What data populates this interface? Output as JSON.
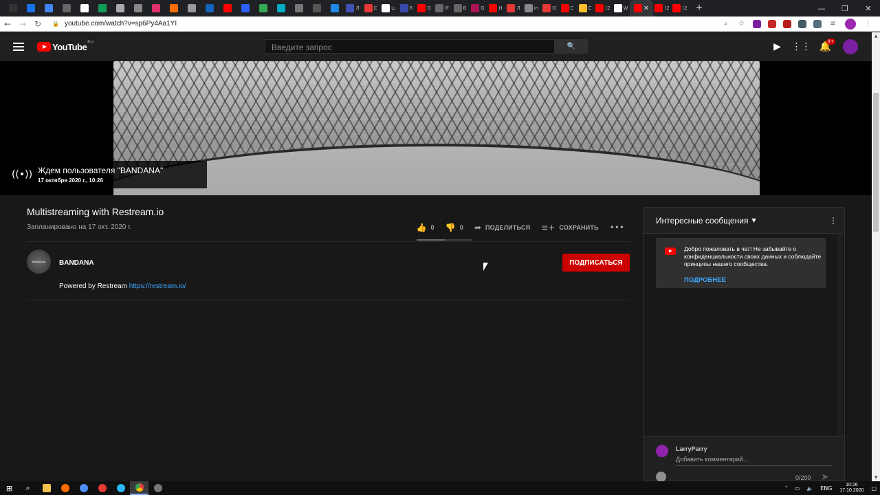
{
  "browser": {
    "tabs": [
      {
        "label": "",
        "color": "#333333"
      },
      {
        "label": "",
        "color": "#1a73e8"
      },
      {
        "label": "",
        "color": "#4285f4"
      },
      {
        "label": "",
        "color": "#666666"
      },
      {
        "label": "",
        "color": "#ffffff"
      },
      {
        "label": "",
        "color": "#0f9d58"
      },
      {
        "label": "",
        "color": "#aaaaaa"
      },
      {
        "label": "",
        "color": "#888888"
      },
      {
        "label": "",
        "color": "#e1306c"
      },
      {
        "label": "",
        "color": "#ff6d00"
      },
      {
        "label": "",
        "color": "#999999"
      },
      {
        "label": "",
        "color": "#1565c0"
      },
      {
        "label": "",
        "color": "#ff0000"
      },
      {
        "label": "",
        "color": "#2962ff"
      },
      {
        "label": "",
        "color": "#34a853"
      },
      {
        "label": "",
        "color": "#00acc1"
      },
      {
        "label": "",
        "color": "#777777"
      },
      {
        "label": "",
        "color": "#555555"
      },
      {
        "label": "",
        "color": "#1e88e5"
      },
      {
        "label": "Л",
        "color": "#3f51b5"
      },
      {
        "label": "С",
        "color": "#e53935"
      },
      {
        "label": "Lı",
        "color": "#ffffff"
      },
      {
        "label": "R",
        "color": "#3949ab"
      },
      {
        "label": "О",
        "color": "#ff0000"
      },
      {
        "label": "IF",
        "color": "#666666"
      },
      {
        "label": "В",
        "color": "#666666"
      },
      {
        "label": "G",
        "color": "#ad1457"
      },
      {
        "label": "Н",
        "color": "#ff0000"
      },
      {
        "label": "Л",
        "color": "#e53935"
      },
      {
        "label": "in",
        "color": "#888888"
      },
      {
        "label": "О",
        "color": "#e53935"
      },
      {
        "label": "С",
        "color": "#ff0000"
      },
      {
        "label": "С",
        "color": "#fbc02d"
      },
      {
        "label": "(2",
        "color": "#ff0000"
      },
      {
        "label": "W",
        "color": "#ffffff"
      },
      {
        "label": "",
        "color": "#ff0000"
      },
      {
        "label": "(2",
        "color": "#ff0000"
      },
      {
        "label": "(2",
        "color": "#ff0000"
      }
    ],
    "new_tab": "+",
    "url": "youtube.com/watch?v=sp6Py4Aa1YI",
    "window_controls": {
      "minimize": "—",
      "restore": "❐",
      "close": "✕"
    }
  },
  "masthead": {
    "logo_text": "YouTube",
    "logo_region": "RU",
    "search_placeholder": "Введите запрос",
    "notification_count": "9+"
  },
  "video": {
    "waiting_title": "Ждем пользователя \"BANDANA\"",
    "waiting_date": "17 октября 2020 г., 10:26"
  },
  "info": {
    "title": "Multistreaming with Restream.io",
    "scheduled": "Запланировано на 17 окт. 2020 г.",
    "likes": "0",
    "dislikes": "0",
    "share_label": "ПОДЕЛИТЬСЯ",
    "save_label": "СОХРАНИТЬ",
    "like_ratio": 0.5
  },
  "owner": {
    "name": "BANDANA",
    "avatar_text": "BANDANA",
    "subscribe_label": "ПОДПИСАТЬСЯ",
    "description_text": "Powered by Restream ",
    "description_link": "https://restream.io/"
  },
  "chat": {
    "header_title": "Интересные сообщения",
    "welcome_text": "Добро пожаловать в чат! Не забывайте о конфиденциальности своих данных и соблюдайте принципы нашего сообщества.",
    "welcome_link": "ПОДРОБНЕЕ",
    "username": "LarryParry",
    "input_placeholder": "Добавить комментарий...",
    "char_count": "0/200"
  },
  "taskbar": {
    "language": "ENG",
    "time": "10:26",
    "date": "17.10.2020"
  },
  "colors": {
    "accent_red": "#cc0000",
    "link_blue": "#3ea6ff",
    "background": "#181818"
  }
}
